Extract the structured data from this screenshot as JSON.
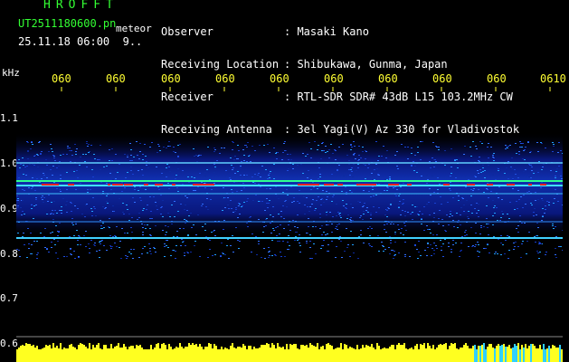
{
  "logo": "HROFFT",
  "file_name": "UT2511180600.pn",
  "file_suffix": "meteor",
  "date_time": "25.11.18 06:00",
  "date_extra": "9..",
  "info": [
    {
      "label": "Observer",
      "value": ": Masaki Kano"
    },
    {
      "label": "Receiving Location",
      "value": ": Shibukawa, Gunma, Japan"
    },
    {
      "label": "Receiver",
      "value": ": RTL-SDR SDR# 43dB L15 103.2MHz CW"
    },
    {
      "label": "Receiving Antenna",
      "value": ": 3el Yagi(V) Az 330 for Vladivostok"
    }
  ],
  "time_ticks": [
    "060",
    "060",
    "060",
    "060",
    "060",
    "060",
    "060",
    "060",
    "060",
    "0610"
  ],
  "y_unit": "kHz",
  "y_ticks": [
    "1.1",
    "1.0",
    "0.9",
    "0.8",
    "0.7",
    "0.6"
  ],
  "colors": {
    "header_green": "#33ff33",
    "tick_yellow": "#ffff33",
    "echo_red": "#ff2020",
    "background_blue": "#0a1a8a"
  }
}
